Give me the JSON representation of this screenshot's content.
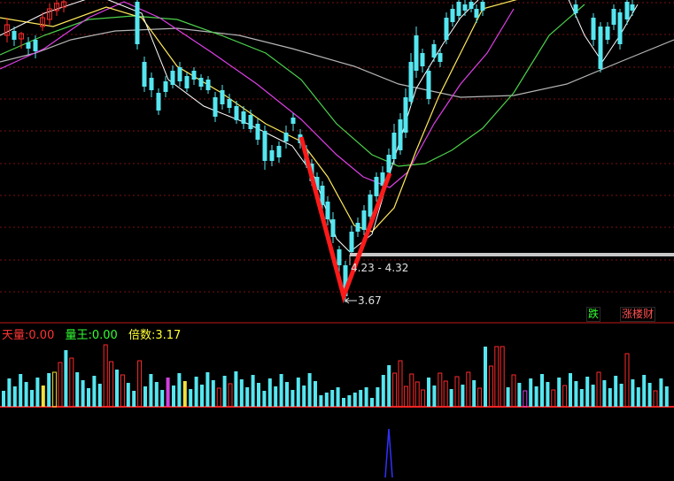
{
  "price_annotations": {
    "range_label": "4.23 - 4.32",
    "low_label": "3.67"
  },
  "badges": {
    "down": "跌",
    "up_wealth": "涨楼财"
  },
  "indicator": {
    "items": [
      {
        "label": "天量:",
        "value": "0.00",
        "color": "#ff3333"
      },
      {
        "label": "量王:",
        "value": "0.00",
        "color": "#33ff33"
      },
      {
        "label": "倍数:",
        "value": "3.17",
        "color": "#ffff33"
      }
    ]
  },
  "colors": {
    "up": "#ff2a2a",
    "down": "#55e6f0",
    "ma5": "#ffffff",
    "ma10": "#ffe95a",
    "ma20": "#e040e8",
    "ma30": "#4cd34c",
    "ma60": "#b5b5b5",
    "grid": "#7a1010",
    "vol_magenta": "#d040e0",
    "vol_yellow": "#f0e040"
  },
  "chart_data": {
    "type": "candlestick",
    "low_price": 3.67,
    "resistance_range": [
      4.23,
      4.32
    ],
    "series": [
      "ma5",
      "ma10",
      "ma20",
      "ma30",
      "ma60",
      "volume"
    ]
  }
}
